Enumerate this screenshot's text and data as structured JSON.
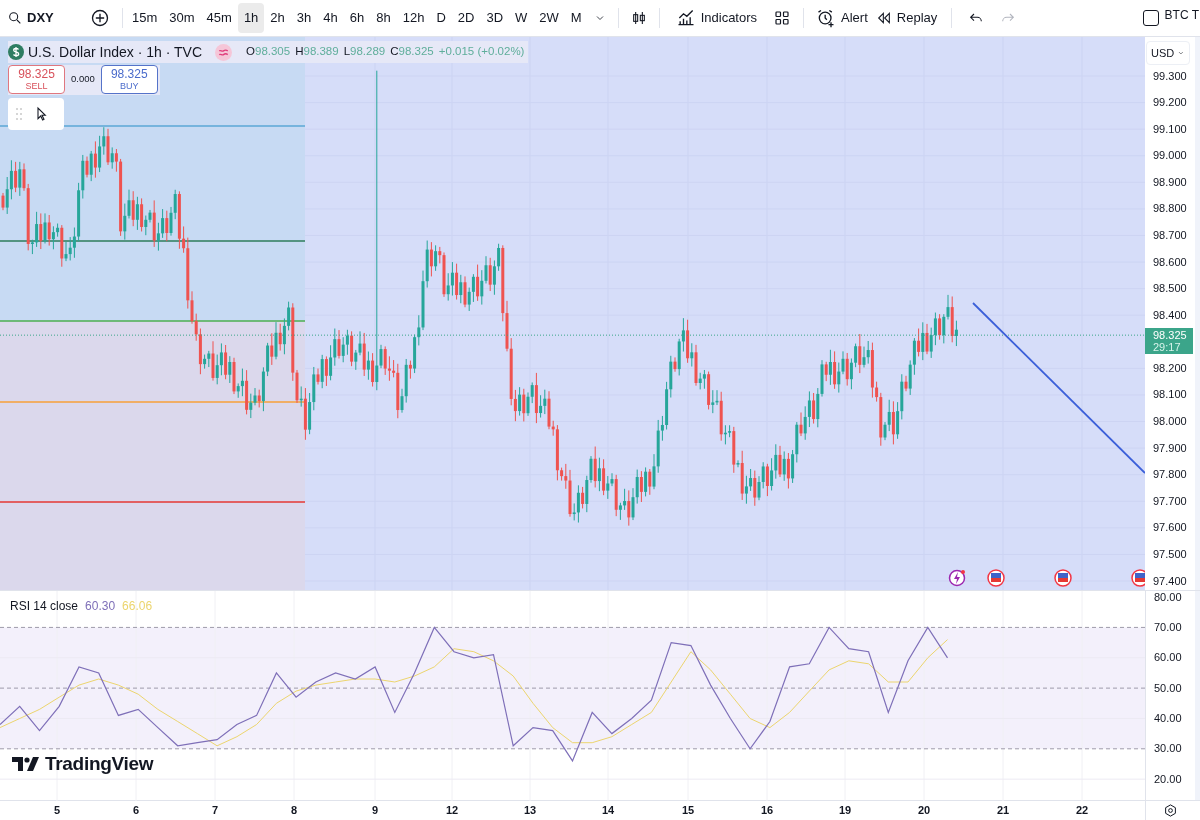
{
  "toolbar": {
    "symbol": "DXY",
    "intervals": [
      {
        "label": "15m",
        "selected": false
      },
      {
        "label": "30m",
        "selected": false
      },
      {
        "label": "45m",
        "selected": false
      },
      {
        "label": "1h",
        "selected": true
      },
      {
        "label": "2h",
        "selected": false
      },
      {
        "label": "3h",
        "selected": false
      },
      {
        "label": "4h",
        "selected": false
      },
      {
        "label": "6h",
        "selected": false
      },
      {
        "label": "8h",
        "selected": false
      },
      {
        "label": "12h",
        "selected": false
      },
      {
        "label": "D",
        "selected": false
      },
      {
        "label": "2D",
        "selected": false
      },
      {
        "label": "3D",
        "selected": false
      },
      {
        "label": "W",
        "selected": false
      },
      {
        "label": "2W",
        "selected": false
      },
      {
        "label": "M",
        "selected": false
      }
    ],
    "buttons": [
      {
        "kind": "indicators",
        "label": "Indicators"
      },
      {
        "kind": "alert",
        "label": "Alert"
      },
      {
        "kind": "replay",
        "label": "Replay"
      }
    ],
    "history": [
      {
        "kind": "undo",
        "disabled": false
      },
      {
        "kind": "redo",
        "disabled": true
      }
    ],
    "watchlist": {
      "label": "BTC T",
      "checked": false
    }
  },
  "legend": {
    "title": "U.S. Dollar Index · 1h · TVC",
    "ohlc": [
      {
        "label": "O",
        "value": "98.305"
      },
      {
        "label": "H",
        "value": "98.389"
      },
      {
        "label": "L",
        "value": "98.289"
      },
      {
        "label": "C",
        "value": "98.325"
      }
    ],
    "change": "+0.015 (+0.02%)",
    "sell": {
      "price": "98.325",
      "label": "SELL"
    },
    "spread": "0.000",
    "buy": {
      "price": "98.325",
      "label": "BUY"
    }
  },
  "price_axis": {
    "currency": "USD",
    "ticks": [
      "99.300",
      "99.200",
      "99.100",
      "99.000",
      "98.900",
      "98.800",
      "98.700",
      "98.600",
      "98.500",
      "98.400",
      "98.200",
      "98.100",
      "98.000",
      "97.900",
      "97.800",
      "97.700",
      "97.600",
      "97.500",
      "97.400"
    ],
    "current": {
      "price": "98.325",
      "countdown": "29:17"
    }
  },
  "rsi": {
    "label": "RSI 14 close",
    "value": "60.30",
    "ma_value": "66.06",
    "chart_data": {
      "type": "line",
      "series": [
        {
          "color": "#7e6fb8",
          "values": [
            38,
            44,
            36,
            44,
            57,
            55,
            41,
            43,
            37,
            31,
            32,
            33,
            38,
            41,
            55,
            47,
            52,
            55,
            53,
            57,
            42,
            55,
            70,
            62,
            60,
            61,
            31,
            37,
            36,
            26,
            42,
            35,
            40,
            46,
            65,
            64,
            51,
            40,
            30,
            39,
            57,
            58,
            70,
            63,
            62,
            42,
            59,
            70,
            60
          ]
        },
        {
          "color": "#ecd56e",
          "values": [
            37,
            40,
            43,
            47,
            51,
            53,
            51,
            48,
            43,
            39,
            35,
            31,
            34,
            38,
            45,
            49,
            51,
            52,
            53,
            53,
            52,
            54,
            57,
            63,
            62,
            59,
            54,
            45,
            37,
            32,
            32,
            34,
            38,
            42,
            52,
            62,
            56,
            48,
            40,
            37,
            42,
            49,
            56,
            59,
            58,
            52,
            52,
            60,
            66
          ]
        }
      ],
      "ylim": [
        12.8,
        82
      ],
      "grid": true,
      "yticks": [
        {
          "value": 80,
          "label": "80.00"
        },
        {
          "value": 70,
          "label": "70.00"
        },
        {
          "value": 60,
          "label": "60.00"
        },
        {
          "value": 50,
          "label": "50.00"
        },
        {
          "value": 40,
          "label": "40.00"
        },
        {
          "value": 30,
          "label": "30.00"
        },
        {
          "value": 20,
          "label": "20.00"
        }
      ]
    }
  },
  "time_axis": [
    "5",
    "6",
    "7",
    "8",
    "9",
    "12",
    "13",
    "14",
    "15",
    "16",
    "19",
    "20",
    "21",
    "22"
  ],
  "branding": "TradingView"
}
